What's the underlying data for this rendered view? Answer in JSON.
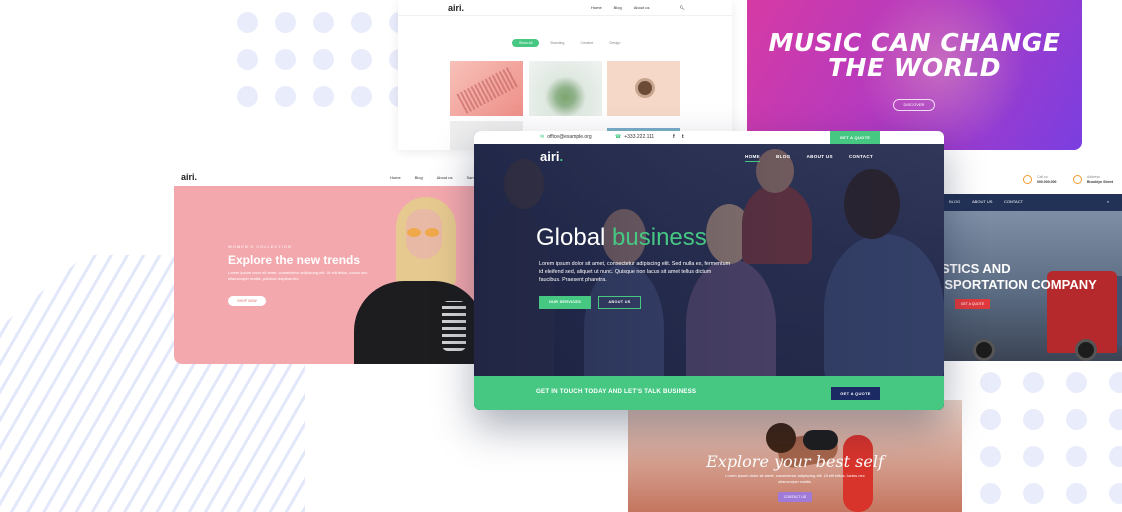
{
  "portfolio_card": {
    "logo": "airi.",
    "nav": [
      "Home",
      "Blog",
      "About us"
    ],
    "filters": [
      "Show All",
      "Branding",
      "Creative",
      "Design"
    ]
  },
  "music_card": {
    "title_line1": "MUSIC CAN CHANGE",
    "title_line2": "THE WORLD",
    "button": "DISCOVER",
    "gradient": [
      "#d63aa4",
      "#7a3ee0"
    ]
  },
  "fashion_card": {
    "logo": "airi.",
    "nav": [
      "Home",
      "Blog",
      "About us",
      "Sample"
    ],
    "kicker": "WOMEN'S COLLECTION",
    "title": "Explore the new trends",
    "text": "Lorem ipsum dolor sit amet, consectetur adipiscing elit. Ut elit tellus, luctus nec ullamcorper mattis, pulvinar dapibus leo.",
    "button": "SHOP NOW"
  },
  "transport_card": {
    "info1_label": "Call us",
    "info1_value": "000.000.000",
    "info2_label": "Address",
    "info2_value": "Brooklyn Street",
    "nav": [
      "BLOG",
      "ABOUT US",
      "CONTACT"
    ],
    "headline_line1": "STICS AND",
    "headline_line2": "NSPORTATION COMPANY",
    "button": "GET A QUOTE"
  },
  "fitness_card": {
    "title": "Explore your best self",
    "text": "Lorem ipsum dolor sit amet, consectetur adipiscing elit. Ut elit tellus, luctus nec ullamcorper mattis.",
    "button": "CONTACT US"
  },
  "business_card": {
    "topbar": {
      "email": "office@example.org",
      "phone": "+333.222.111",
      "social": [
        "f",
        "t"
      ],
      "quote_button": "GET A QUOTE"
    },
    "logo": "airi",
    "logo_dot": ".",
    "nav": [
      "HOME",
      "BLOG",
      "ABOUT US",
      "CONTACT"
    ],
    "headline_part1": "Global",
    "headline_part2": "business",
    "paragraph": "Lorem ipsum dolor sit amet, consectetur adipiscing elit. Sed nulla ex, fermentum id eleifend sed, aliquet ut nunc. Quisque non lacus sit amet tellus dictum faucibus. Praesent pharetra.",
    "btn_services": "OUR SERVICES",
    "btn_about": "ABOUT US",
    "cta_text": "GET IN TOUCH TODAY AND LET'S TALK BUSINESS",
    "cta_button": "GET A QUOTE",
    "accent_color": "#46c883",
    "cta_button_color": "#1c2a63"
  }
}
